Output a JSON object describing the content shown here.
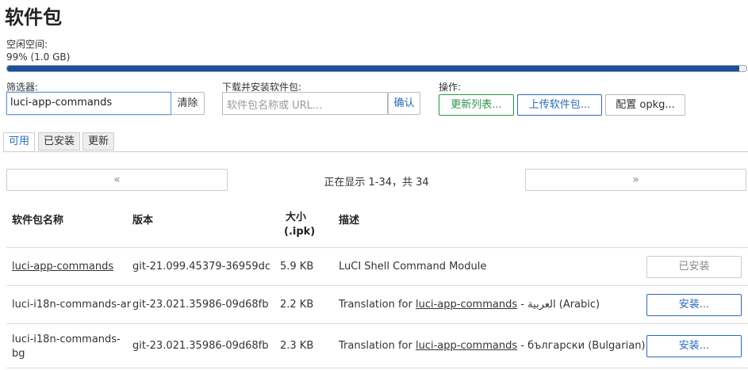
{
  "page": {
    "title": "软件包"
  },
  "storage": {
    "label": "空闲空间:",
    "value": "99% (1.0 GB)",
    "percent": 99
  },
  "filter": {
    "label": "筛选器:",
    "value": "luci-app-commands",
    "clear_label": "清除"
  },
  "download": {
    "label": "下载并安装软件包:",
    "placeholder": "软件包名称或 URL...",
    "ok_label": "确认"
  },
  "actions": {
    "label": "操作:",
    "update": "更新列表...",
    "upload": "上传软件包...",
    "configure": "配置 opkg..."
  },
  "tabs": [
    {
      "label": "可用"
    },
    {
      "label": "已安装"
    },
    {
      "label": "更新"
    }
  ],
  "pager": {
    "prev": "«",
    "next": "»",
    "status": "正在显示 1-34，共 34"
  },
  "table": {
    "headers": {
      "name": "软件包名称",
      "version": "版本",
      "size_line1": "大小",
      "size_line2": "(.ipk)",
      "desc": "描述"
    },
    "rows": [
      {
        "name": "luci-app-commands",
        "version": "git-21.099.45379-36959dc",
        "size": "5.9 KB",
        "desc_text": "LuCI Shell Command Module",
        "action": "已安装"
      },
      {
        "name": "luci-i18n-commands-ar",
        "version": "git-23.021.35986-09d68fb",
        "size": "2.2 KB",
        "desc_prefix": "Translation for ",
        "desc_link": "luci-app-commands",
        "desc_suffix": " - العربية (Arabic)",
        "action": "安装..."
      },
      {
        "name_line1": "luci-i18n-commands-",
        "name_line2": "bg",
        "version": "git-23.021.35986-09d68fb",
        "size": "2.3 KB",
        "desc_prefix": "Translation for ",
        "desc_link": "luci-app-commands",
        "desc_suffix": " - български (Bulgarian)",
        "action": "安装..."
      }
    ]
  }
}
